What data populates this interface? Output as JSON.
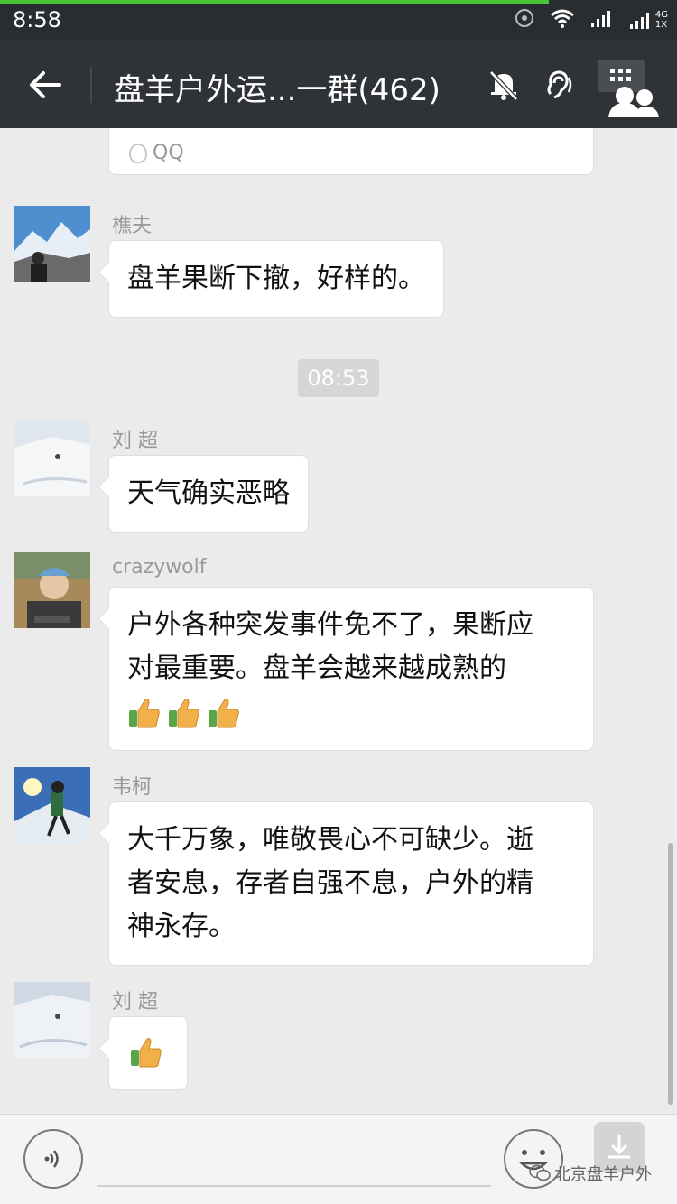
{
  "status_bar": {
    "time": "8:58",
    "network_label": "4G",
    "network_sublabel": "1X",
    "accent_color": "#46c637"
  },
  "nav": {
    "title": "盘羊户外运...一群(462)",
    "back_icon": "back-arrow-icon",
    "mute_icon": "bell-muted-icon",
    "ear_icon": "earpiece-icon",
    "members_icon": "group-members-icon"
  },
  "shared_card": {
    "source": "QQ"
  },
  "messages": [
    {
      "sender": "樵夫",
      "text": "盘羊果断下撤，好样的。"
    },
    {
      "sender": "刘 超",
      "text": "天气确实恶略"
    },
    {
      "sender": "crazywolf",
      "line1": "户外各种突发事件免不了，果断应",
      "line2": "对最重要。盘羊会越来越成熟的",
      "thumbs_count": 3
    },
    {
      "sender": "韦柯",
      "line1": "大千万象，唯敬畏心不可缺少。逝",
      "line2": "者安息，存者自强不息，户外的精",
      "line3": "神永存。"
    },
    {
      "sender": "刘 超",
      "thumbs_count": 1
    }
  ],
  "time_divider": "08:53",
  "input_bar": {
    "voice_icon": "voice-icon",
    "emoji_icon": "emoji-icon",
    "download_icon": "download-icon"
  },
  "watermark": {
    "text": "北京盘羊户外",
    "icon": "wechat-icon"
  }
}
